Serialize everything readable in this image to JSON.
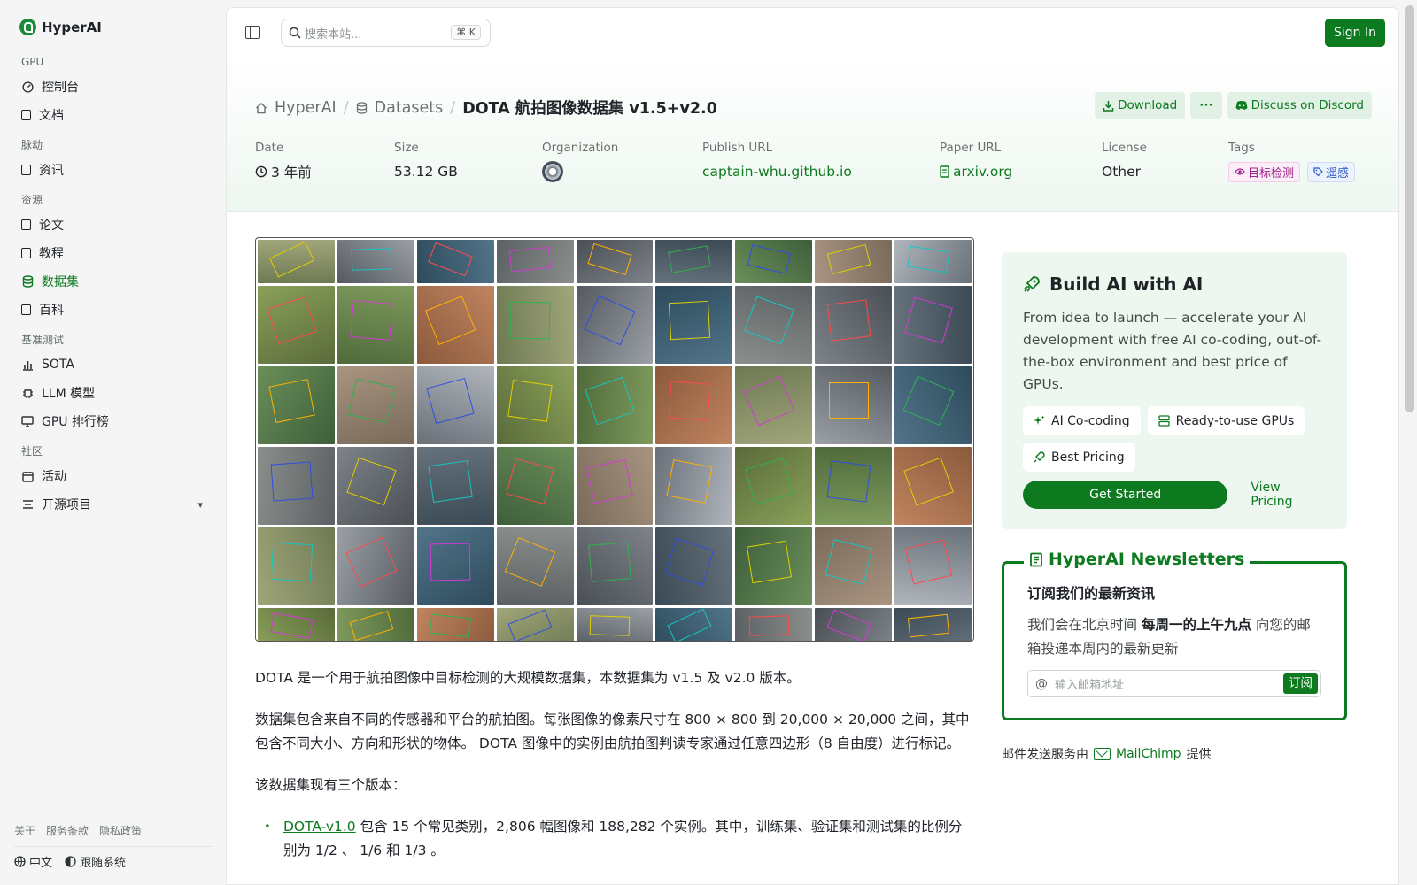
{
  "brand": {
    "name": "HyperAI"
  },
  "sidebar": {
    "sections": [
      {
        "label": "GPU",
        "items": [
          {
            "label": "控制台",
            "icon": "gauge-icon"
          },
          {
            "label": "文档",
            "icon": "doc-icon"
          }
        ]
      },
      {
        "label": "脉动",
        "items": [
          {
            "label": "资讯",
            "icon": "news-icon"
          }
        ]
      },
      {
        "label": "资源",
        "items": [
          {
            "label": "论文",
            "icon": "paper-icon"
          },
          {
            "label": "教程",
            "icon": "book-icon"
          },
          {
            "label": "数据集",
            "icon": "database-icon",
            "active": true
          },
          {
            "label": "百科",
            "icon": "wiki-icon"
          }
        ]
      },
      {
        "label": "基准测试",
        "items": [
          {
            "label": "SOTA",
            "icon": "chart-icon"
          },
          {
            "label": "LLM 模型",
            "icon": "chip-icon"
          },
          {
            "label": "GPU 排行榜",
            "icon": "monitor-icon"
          }
        ]
      },
      {
        "label": "社区",
        "items": [
          {
            "label": "活动",
            "icon": "calendar-icon"
          },
          {
            "label": "开源项目",
            "icon": "list-icon",
            "expandable": true
          }
        ]
      }
    ],
    "footer_links": [
      "关于",
      "服务条款",
      "隐私政策"
    ],
    "language": "中文",
    "theme": "跟随系统"
  },
  "topbar": {
    "search_placeholder": "搜索本站...",
    "shortcut": "K",
    "signin": "Sign In"
  },
  "header": {
    "breadcrumb": {
      "home": "HyperAI",
      "section": "Datasets",
      "current": "DOTA 航拍图像数据集 v1.5+v2.0"
    },
    "actions": {
      "download": "Download",
      "more": "···",
      "discord": "Discuss on Discord"
    },
    "meta": {
      "date_label": "Date",
      "date_value": "3 年前",
      "size_label": "Size",
      "size_value": "53.12 GB",
      "org_label": "Organization",
      "publish_label": "Publish URL",
      "publish_value": "captain-whu.github.io",
      "paper_label": "Paper URL",
      "paper_value": "arxiv.org",
      "license_label": "License",
      "license_value": "Other",
      "tags_label": "Tags",
      "tag1": "目标检测",
      "tag2": "遥感"
    }
  },
  "content": {
    "p1": "DOTA 是一个用于航拍图像中目标检测的大规模数据集，本数据集为 v1.5 及 v2.0 版本。",
    "p2": "数据集包含来自不同的传感器和平台的航拍图。每张图像的像素尺寸在 800 × 800 到 20,000 × 20,000 之间，其中包含不同大小、方向和形状的物体。 DOTA 图像中的实例由航拍图判读专家通过任意四边形（8 自由度）进行标记。",
    "p3": "该数据集现有三个版本：",
    "li1_link": "DOTA-v1.0",
    "li1_text": " 包含 15 个常见类别，2,806 幅图像和 188,282 个实例。其中，训练集、验证集和测试集的比例分别为 1/2 、 1/6 和 1/3 。"
  },
  "promo": {
    "title": "Build AI with AI",
    "desc": "From idea to launch — accelerate your AI development with free AI co-coding, out-of-the-box environment and best price of GPUs.",
    "features": [
      "AI Co-coding",
      "Ready-to-use GPUs",
      "Best Pricing"
    ],
    "cta": "Get Started",
    "secondary": "View Pricing"
  },
  "newsletter": {
    "legend": "HyperAI Newsletters",
    "title": "订阅我们的最新资讯",
    "desc_pre": "我们会在北京时间 ",
    "desc_bold": "每周一的上午九点",
    "desc_post": " 向您的邮箱投递本周内的最新更新",
    "placeholder": "输入邮箱地址",
    "subscribe": "订阅",
    "powered_pre": "邮件发送服务由",
    "powered_brand": "MailChimp",
    "powered_post": "提供"
  },
  "colors": {
    "accent": "#0d7a1f",
    "tag_pink": "#a1208b",
    "tag_blue": "#275ac7"
  }
}
